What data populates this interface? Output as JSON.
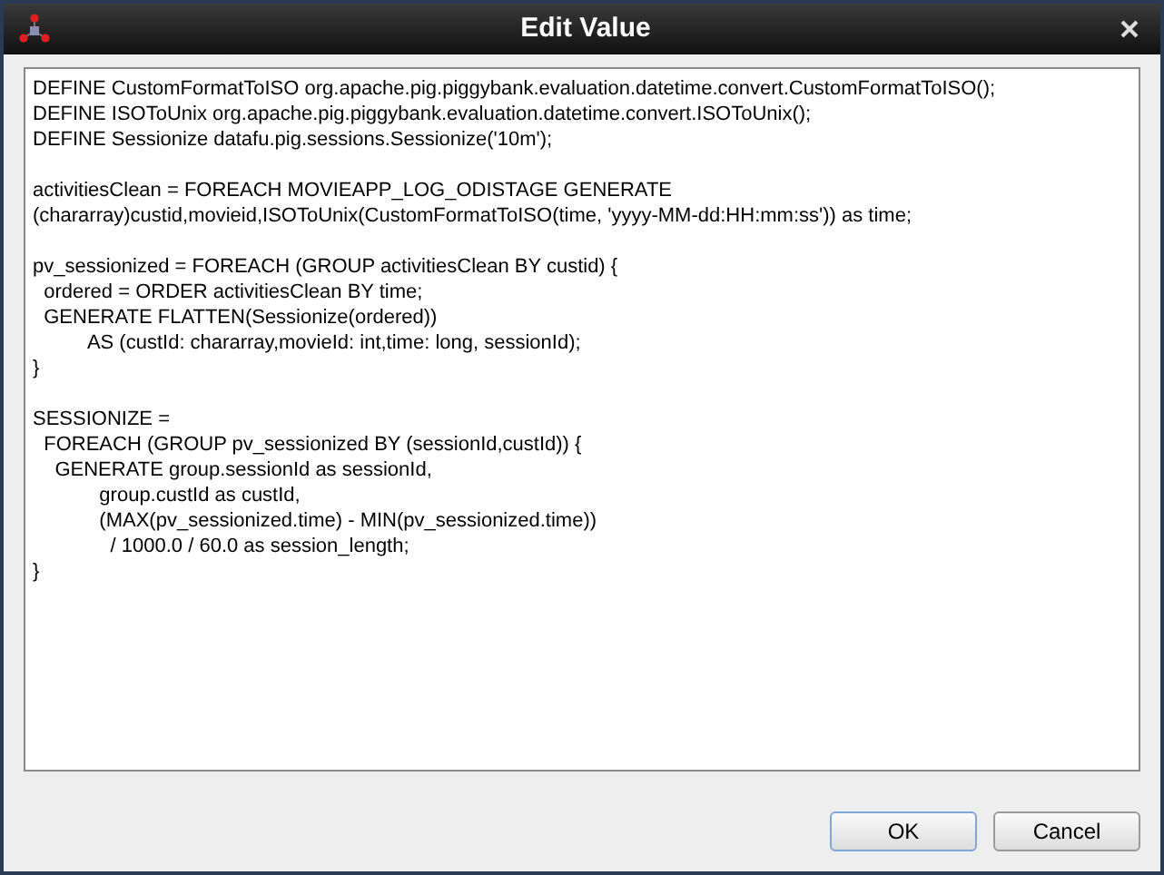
{
  "window": {
    "title": "Edit Value"
  },
  "editor": {
    "blocks": [
      [
        "DEFINE CustomFormatToISO org.apache.pig.piggybank.evaluation.datetime.convert.CustomFormatToISO();",
        "DEFINE ISOToUnix org.apache.pig.piggybank.evaluation.datetime.convert.ISOToUnix();",
        "DEFINE Sessionize datafu.pig.sessions.Sessionize('10m');"
      ],
      [
        "activitiesClean = FOREACH MOVIEAPP_LOG_ODISTAGE GENERATE",
        "(chararray)custid,movieid,ISOToUnix(CustomFormatToISO(time, 'yyyy-MM-dd:HH:mm:ss')) as time;"
      ],
      [
        "pv_sessionized = FOREACH (GROUP activitiesClean BY custid) {",
        "  ordered = ORDER activitiesClean BY time;",
        "  GENERATE FLATTEN(Sessionize(ordered))",
        "          AS (custId: chararray,movieId: int,time: long, sessionId);",
        "}"
      ],
      [
        "SESSIONIZE =",
        "  FOREACH (GROUP pv_sessionized BY (sessionId,custId)) {",
        "    GENERATE group.sessionId as sessionId,",
        "            group.custId as custId,",
        "            (MAX(pv_sessionized.time) - MIN(pv_sessionized.time))",
        "              / 1000.0 / 60.0 as session_length;",
        "}"
      ]
    ]
  },
  "buttons": [
    {
      "label": "OK",
      "selected": true
    },
    {
      "label": "Cancel",
      "selected": false
    }
  ]
}
